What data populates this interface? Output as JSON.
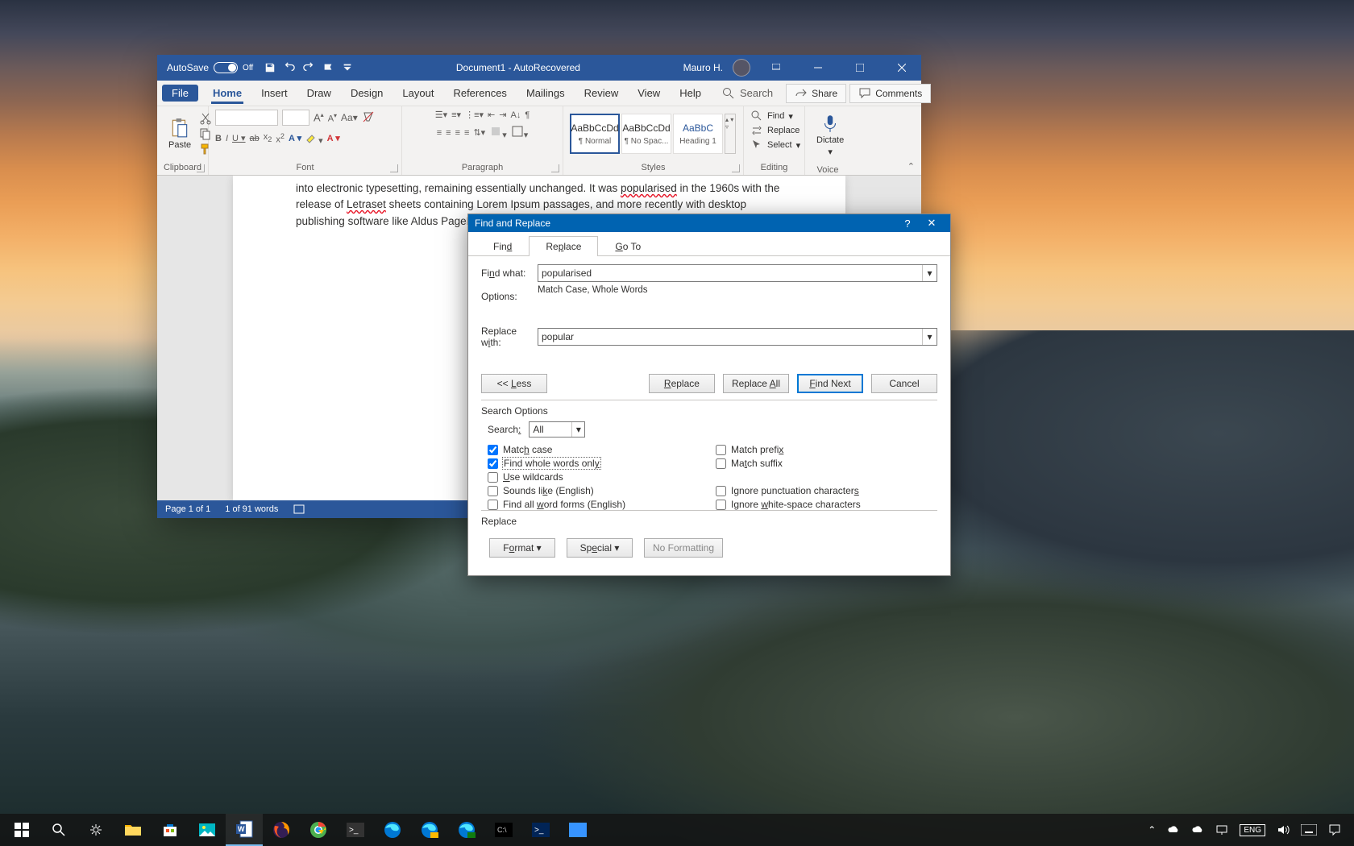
{
  "titleBar": {
    "autoSave": "AutoSave",
    "autoSaveState": "Off",
    "docTitle": "Document1  -  AutoRecovered",
    "userName": "Mauro H."
  },
  "ribbonTabs": {
    "file": "File",
    "home": "Home",
    "insert": "Insert",
    "draw": "Draw",
    "design": "Design",
    "layout": "Layout",
    "references": "References",
    "mailings": "Mailings",
    "review": "Review",
    "view": "View",
    "help": "Help",
    "search": "Search",
    "share": "Share",
    "comments": "Comments"
  },
  "ribbonGroups": {
    "clipboard": "Clipboard",
    "paste": "Paste",
    "font": "Font",
    "paragraph": "Paragraph",
    "styles": "Styles",
    "editing": "Editing",
    "voice": "Voice",
    "find": "Find",
    "replace": "Replace",
    "select": "Select",
    "dictate": "Dictate",
    "style1": "¶ Normal",
    "style2": "¶ No Spac...",
    "style3": "Heading 1",
    "stylePreview": "AaBbCcDd",
    "stylePreview3": "AaBbC"
  },
  "document": {
    "line1a": "into electronic typesetting, remaining essentially unchanged. It was ",
    "line1b": "popularised",
    "line1c": " in the 1960s with the",
    "line2a": "release of ",
    "line2b": "Letraset",
    "line2c": " sheets containing Lorem Ipsum passages, and more recently with desktop publishing",
    "line3": "software like Aldus PageMaker including versions of Lorem Ipsum."
  },
  "statusBar": {
    "page": "Page 1 of 1",
    "words": "1 of 91 words"
  },
  "dialog": {
    "title": "Find and Replace",
    "tabs": {
      "find": "Find",
      "replace": "Replace",
      "goto": "Go To"
    },
    "findWhatLabel": "Find what:",
    "findWhatValue": "popularised",
    "optionsLabel": "Options:",
    "optionsValue": "Match Case, Whole Words",
    "replaceWithLabel": "Replace with:",
    "replaceWithValue": "popular",
    "buttons": {
      "less": "<< Less",
      "replace": "Replace",
      "replaceAll": "Replace All",
      "findNext": "Find Next",
      "cancel": "Cancel",
      "format": "Format",
      "special": "Special",
      "noFormatting": "No Formatting"
    },
    "searchOptions": "Search Options",
    "searchLabel": "Search:",
    "searchValue": "All",
    "checks": {
      "matchCase": "Match case",
      "wholeWords": "Find whole words only",
      "wildcards": "Use wildcards",
      "soundsLike": "Sounds like (English)",
      "wordForms": "Find all word forms (English)",
      "matchPrefix": "Match prefix",
      "matchSuffix": "Match suffix",
      "ignorePunct": "Ignore punctuation characters",
      "ignoreWhite": "Ignore white-space characters"
    },
    "replaceSection": "Replace"
  },
  "tray": {
    "time": "",
    "date": ""
  }
}
